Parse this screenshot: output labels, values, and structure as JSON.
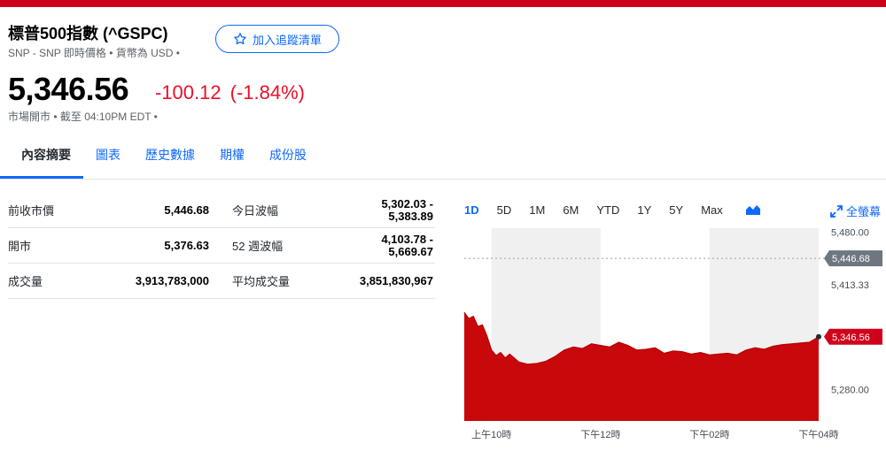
{
  "header": {
    "title": "標普500指數 (^GSPC)",
    "subtitle": "SNP - SNP 即時價格 • 貨幣為 USD •",
    "watchlist_label": "加入追蹤清單"
  },
  "quote": {
    "price": "5,346.56",
    "change": "-100.12",
    "change_pct": "(-1.84%)",
    "status": "市場開市 • 截至 04:10PM EDT •"
  },
  "tabs": [
    {
      "label": "內容摘要",
      "active": true
    },
    {
      "label": "圖表"
    },
    {
      "label": "歷史數據"
    },
    {
      "label": "期權"
    },
    {
      "label": "成份股"
    }
  ],
  "stats": [
    [
      {
        "label": "前收市價",
        "value": "5,446.68"
      },
      {
        "label": "今日波幅",
        "value": "5,302.03 -",
        "value2": "5,383.89"
      }
    ],
    [
      {
        "label": "開市",
        "value": "5,376.63"
      },
      {
        "label": "52 週波幅",
        "value": "4,103.78 -",
        "value2": "5,669.67"
      }
    ],
    [
      {
        "label": "成交量",
        "value": "3,913,783,000"
      },
      {
        "label": "平均成交量",
        "value": "3,851,830,967"
      }
    ]
  ],
  "chart": {
    "ranges": [
      "1D",
      "5D",
      "1M",
      "6M",
      "YTD",
      "1Y",
      "5Y",
      "Max"
    ],
    "active_range": "1D",
    "fullscreen_label": "全螢幕",
    "icons": {
      "chart_type": "mountain-chart-icon",
      "fullscreen": "expand-icon",
      "watch": "star-icon"
    },
    "colors": {
      "area": "#c9080b",
      "line": "#b40000",
      "band": "#f0f0f0",
      "accent": "#0f69ff",
      "down": "#eb0f29"
    }
  },
  "chart_data": {
    "type": "area",
    "y_ticks": [
      "5,480.00",
      "5,413.33",
      "5,280.00"
    ],
    "x_ticks": [
      "上午10時",
      "下午12時",
      "下午02時",
      "下午04時"
    ],
    "ylim": [
      5240,
      5485
    ],
    "prev_close": 5446.68,
    "prev_close_label": "5,446.68",
    "last_label": "5,346.56",
    "x": [
      "09:30",
      "09:35",
      "09:40",
      "09:45",
      "09:50",
      "09:55",
      "10:00",
      "10:05",
      "10:10",
      "10:15",
      "10:20",
      "10:30",
      "10:40",
      "10:50",
      "11:00",
      "11:10",
      "11:20",
      "11:30",
      "11:40",
      "11:50",
      "12:00",
      "12:10",
      "12:20",
      "12:30",
      "12:40",
      "12:50",
      "13:00",
      "13:10",
      "13:20",
      "13:30",
      "13:40",
      "13:50",
      "14:00",
      "14:10",
      "14:20",
      "14:30",
      "14:40",
      "14:50",
      "15:00",
      "15:10",
      "15:20",
      "15:30",
      "15:40",
      "15:50",
      "16:00"
    ],
    "values": [
      5378,
      5370,
      5373,
      5360,
      5362,
      5348,
      5330,
      5323,
      5327,
      5320,
      5325,
      5315,
      5312,
      5313,
      5316,
      5322,
      5330,
      5334,
      5332,
      5338,
      5336,
      5334,
      5340,
      5336,
      5330,
      5331,
      5333,
      5326,
      5329,
      5328,
      5325,
      5327,
      5324,
      5325,
      5326,
      5324,
      5330,
      5333,
      5331,
      5335,
      5337,
      5338,
      5339,
      5340,
      5347
    ]
  }
}
